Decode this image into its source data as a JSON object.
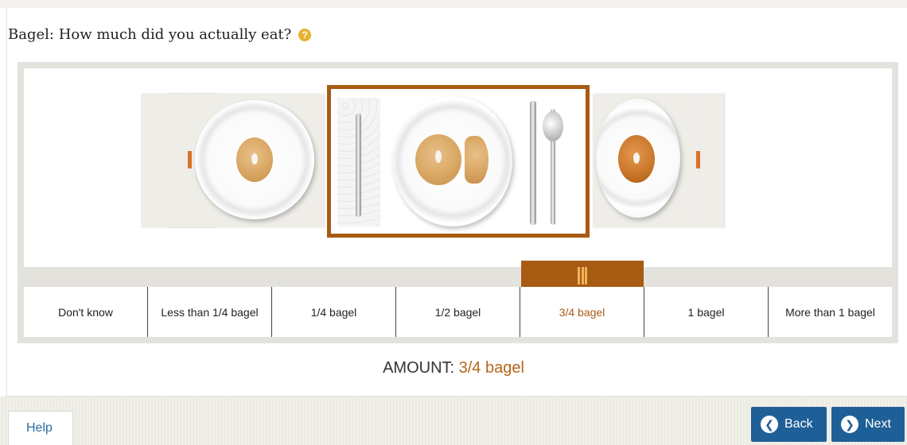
{
  "question": {
    "food": "Bagel:",
    "text": "How much did you actually eat?",
    "help_icon": "?"
  },
  "portion_options": [
    "Don't know",
    "Less than 1/4 bagel",
    "1/4 bagel",
    "1/2 bagel",
    "3/4 bagel",
    "1 bagel",
    "More than 1 bagel"
  ],
  "selected_index": 4,
  "amount": {
    "label": "AMOUNT:",
    "value": "3/4 bagel"
  },
  "footer": {
    "help_label": "Help",
    "back_label": "Back",
    "next_label": "Next"
  },
  "icons": {
    "question_help": "question-circle-icon",
    "back": "arrow-left-circle-icon",
    "next": "arrow-right-circle-icon",
    "slider_grip": "grip-icon"
  },
  "colors": {
    "accent": "#a85b13",
    "button": "#1f5f97",
    "help_icon": "#e7b22f"
  }
}
